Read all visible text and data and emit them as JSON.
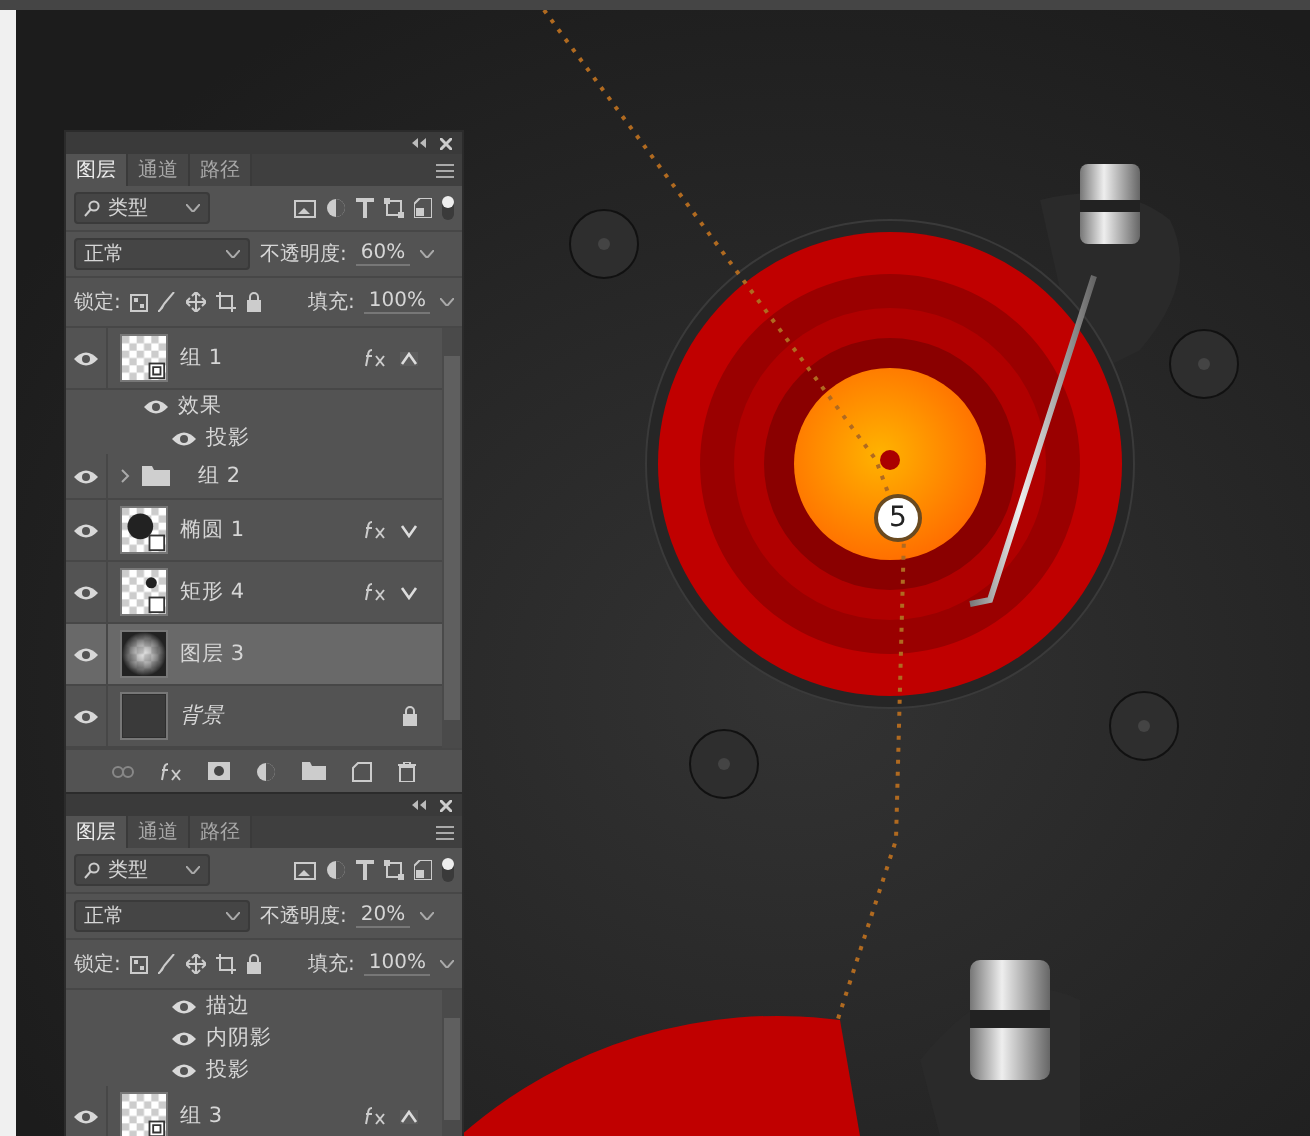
{
  "step_badge": "5",
  "panels": [
    {
      "tabs": [
        {
          "label": "图层",
          "selected": true
        },
        {
          "label": "通道",
          "selected": false
        },
        {
          "label": "路径",
          "selected": false
        }
      ],
      "filter": "类型",
      "blend_mode": "正常",
      "opacity_label": "不透明度:",
      "opacity": "60%",
      "lock_label": "锁定:",
      "fill_label": "填充:",
      "fill": "100%",
      "footer": true,
      "layers": [
        {
          "kind": "layer",
          "name": "组 1",
          "thumbnail": {
            "kind": "smart"
          },
          "visible": true,
          "selected": false,
          "fx": true,
          "fx_expanded": true,
          "locked": false
        },
        {
          "kind": "effects",
          "name": "效果",
          "visible": true
        },
        {
          "kind": "effect",
          "name": "投影",
          "visible": true
        },
        {
          "kind": "group",
          "name": "组 2",
          "visible": true,
          "selected": false
        },
        {
          "kind": "layer",
          "name": "椭圆 1",
          "thumbnail": {
            "kind": "ellipse"
          },
          "visible": true,
          "selected": false,
          "fx": true,
          "fx_expanded": false,
          "locked": false
        },
        {
          "kind": "layer",
          "name": "矩形 4",
          "thumbnail": {
            "kind": "rect"
          },
          "visible": true,
          "selected": false,
          "fx": true,
          "fx_expanded": false,
          "locked": false
        },
        {
          "kind": "layer",
          "name": "图层 3",
          "thumbnail": {
            "kind": "gradient"
          },
          "visible": true,
          "selected": true,
          "fx": false,
          "locked": false
        },
        {
          "kind": "layer",
          "name": "背景",
          "thumbnail": {
            "kind": "dark"
          },
          "visible": true,
          "selected": false,
          "fx": false,
          "locked": true
        }
      ]
    },
    {
      "tabs": [
        {
          "label": "图层",
          "selected": true
        },
        {
          "label": "通道",
          "selected": false
        },
        {
          "label": "路径",
          "selected": false
        }
      ],
      "filter": "类型",
      "blend_mode": "正常",
      "opacity_label": "不透明度:",
      "opacity": "20%",
      "lock_label": "锁定:",
      "fill_label": "填充:",
      "fill": "100%",
      "footer": false,
      "layers": [
        {
          "kind": "effect",
          "name": "描边",
          "visible": true
        },
        {
          "kind": "effect",
          "name": "内阴影",
          "visible": true
        },
        {
          "kind": "effect",
          "name": "投影",
          "visible": true
        },
        {
          "kind": "layer",
          "name": "组 3",
          "thumbnail": {
            "kind": "smart"
          },
          "visible": true,
          "selected": false,
          "fx": true,
          "fx_expanded": true,
          "locked": false
        }
      ]
    }
  ]
}
